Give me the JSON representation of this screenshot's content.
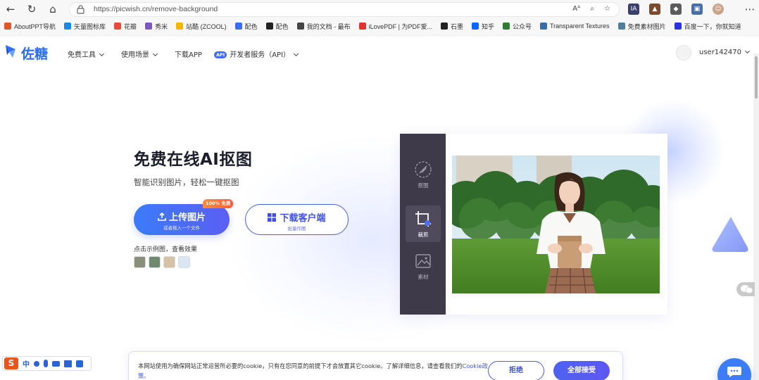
{
  "browser": {
    "url": "https://picwish.cn/remove-background",
    "bookmarks": [
      {
        "label": "AboutPPT导航",
        "color": "#e2562b"
      },
      {
        "label": "矢量图标库",
        "color": "#1e88e5"
      },
      {
        "label": "花瓣",
        "color": "#e84a3a"
      },
      {
        "label": "秀米",
        "color": "#7e57c2"
      },
      {
        "label": "站酷 (ZCOOL)",
        "color": "#f2b800"
      },
      {
        "label": "配色",
        "color": "#3b6cf3"
      },
      {
        "label": "配色",
        "color": "#222222"
      },
      {
        "label": "我的文档 - 最布",
        "color": "#444444"
      },
      {
        "label": "iLovePDF | 为PDF爱...",
        "color": "#e5322d"
      },
      {
        "label": "石墨",
        "color": "#222222"
      },
      {
        "label": "知乎",
        "color": "#0a66ff"
      },
      {
        "label": "公众号",
        "color": "#2e7d32"
      },
      {
        "label": "Transparent Textures",
        "color": "#3a6ea5"
      },
      {
        "label": "免费素材图片",
        "color": "#4d7f9b"
      },
      {
        "label": "百度一下，你就知道",
        "color": "#2932e1"
      }
    ],
    "addr_icons": [
      "Aᴬ",
      "⌕",
      "☆"
    ],
    "toolbar": [
      "IA",
      "▲",
      "◆",
      "▣",
      "☺"
    ]
  },
  "site": {
    "logo": "佐糖",
    "nav": [
      {
        "label": "免费工具",
        "dropdown": true
      },
      {
        "label": "使用场景",
        "dropdown": true
      },
      {
        "label": "下载APP",
        "dropdown": false
      },
      {
        "label": "开发者服务（API）",
        "dropdown": true,
        "badge": "API"
      }
    ],
    "user": "user142470"
  },
  "hero": {
    "title": "免费在线AI抠图",
    "subtitle": "智能识别图片，轻松一键抠图",
    "upload": {
      "label": "上传图片",
      "sub": "或者拖入一个文件",
      "badge": "100% 免费"
    },
    "download": {
      "label": "下载客户端",
      "sub": "批量作图"
    },
    "samples_label": "点击示例图，查看效果",
    "samples": [
      "#8a8f7a",
      "#6f8a6e",
      "#d8c2a5",
      "#dbe6f5"
    ]
  },
  "demo": {
    "tools": [
      {
        "label": "抠图",
        "active": false
      },
      {
        "label": "裁剪",
        "active": true
      },
      {
        "label": "素材",
        "active": false
      }
    ]
  },
  "cookie": {
    "text": "本网站使用为确保网站正常运营所必要的cookie，只有在您同意的前提下才会放置其它cookie。了解详细信息，请查看我们的",
    "link": "Cookie政策。",
    "reject": "拒绝",
    "accept": "全部接受"
  },
  "ime": {
    "logo": "S",
    "mode": "中"
  },
  "colors": {
    "brand": "#3f56e8",
    "accent_orange": "#ff6b3a",
    "sidebar_dark": "#3f3a4a"
  }
}
